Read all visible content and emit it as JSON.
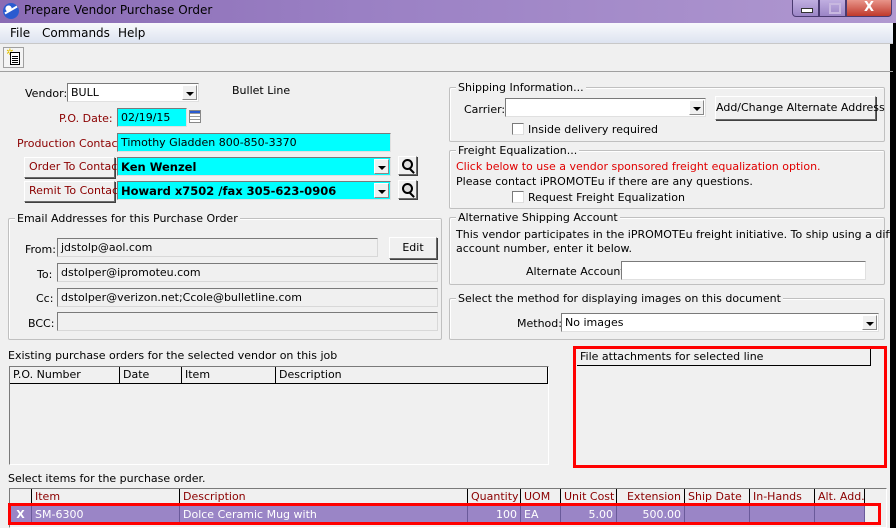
{
  "window": {
    "title": "Prepare Vendor Purchase Order",
    "close_label": "X"
  },
  "menu": [
    "File",
    "Commands",
    "Help"
  ],
  "toolbar": {
    "new_icon": "new-document-icon"
  },
  "vendor": {
    "label": "Vendor:",
    "value": "BULL",
    "name": "Bullet Line"
  },
  "po_date": {
    "label": "P.O. Date:",
    "value": "02/19/15"
  },
  "production_contact": {
    "label": "Production Contact:",
    "value": "Timothy Gladden  800-850-3370"
  },
  "order_to_contact": {
    "label": "Order To Contact:",
    "value": "Ken Wenzel"
  },
  "remit_to_contact": {
    "label": "Remit To Contact:",
    "value": "Howard x7502 /fax 305-623-0906"
  },
  "email": {
    "title": "Email Addresses for this Purchase Order",
    "from_label": "From:",
    "from": "jdstolp@aol.com",
    "edit_label": "Edit",
    "to_label": "To:",
    "to": "dstolper@ipromoteu.com",
    "cc_label": "Cc:",
    "cc": "dstolper@verizon.net;Ccole@bulletline.com",
    "bcc_label": "BCC:",
    "bcc": ""
  },
  "shipping": {
    "title": "Shipping Information...",
    "carrier_label": "Carrier:",
    "carrier": "",
    "alt_address_label": "Add/Change Alternate Address",
    "inside_delivery_label": "Inside delivery required",
    "inside_delivery_checked": false
  },
  "freight": {
    "title": "Freight Equalization...",
    "notice": "Click below to use a vendor sponsored freight equalization option.",
    "contact": "Please contact iPROMOTEu if there are any questions.",
    "request_label": "Request Freight Equalization",
    "request_checked": false
  },
  "alt_shipping": {
    "title": "Alternative Shipping Account",
    "text1": "This vendor participates in the iPROMOTEu freight initiative.  To ship using a different",
    "text2": "account number, enter it below.",
    "account_label": "Alternate Account:",
    "account": ""
  },
  "images": {
    "title": "Select the method for displaying images on this document",
    "method_label": "Method:",
    "method": "No images"
  },
  "existing_po": {
    "title": "Existing purchase orders for the selected vendor on this job",
    "columns": [
      "P.O. Number",
      "Date",
      "Item",
      "Description"
    ],
    "rows": []
  },
  "attachments": {
    "columns": [
      "File attachments for selected line"
    ],
    "rows": []
  },
  "items": {
    "title": "Select items for the purchase order.",
    "columns": [
      "",
      "Item",
      "Description",
      "Quantity",
      "UOM",
      "Unit Cost",
      "Extension",
      "Ship Date",
      "In-Hands",
      "Alt. Add."
    ],
    "rows": [
      [
        "X",
        "SM-6300",
        "Dolce Ceramic Mug with",
        "100",
        "EA",
        "5.00",
        "500.00",
        "",
        "",
        ""
      ]
    ]
  },
  "colors": {
    "highlight_field": "#00ffff",
    "selected_row": "#9a85c6",
    "annotation_box": "#ff0000",
    "label_red": "#8b0000"
  }
}
